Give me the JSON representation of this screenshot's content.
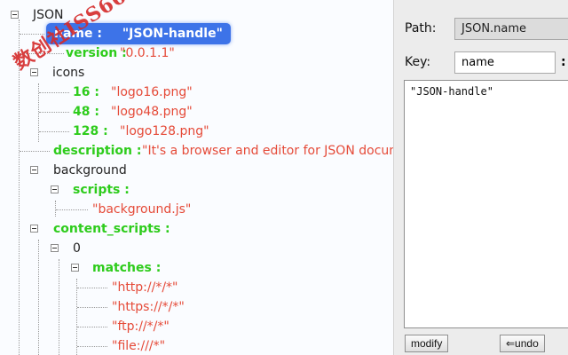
{
  "tree": {
    "root": "JSON",
    "selected": {
      "key": "name",
      "sep": ":",
      "value": "\"JSON-handle\""
    },
    "version": {
      "key": "version",
      "sep": ":",
      "value": "\"0.0.1.1\""
    },
    "icons": {
      "key": "icons"
    },
    "icon16": {
      "key": "16",
      "sep": ":",
      "value": "\"logo16.png\""
    },
    "icon48": {
      "key": "48",
      "sep": ":",
      "value": "\"logo48.png\""
    },
    "icon128": {
      "key": "128",
      "sep": ":",
      "value": "\"logo128.png\""
    },
    "description": {
      "key": "description",
      "sep": ":",
      "value": "\"It's a browser and editor for JSON document."
    },
    "background": {
      "key": "background"
    },
    "scripts": {
      "key": "scripts",
      "sep": ":"
    },
    "script0": {
      "value": "\"background.js\""
    },
    "content_scripts": {
      "key": "content_scripts",
      "sep": ":"
    },
    "cs_index": {
      "key": "0"
    },
    "matches": {
      "key": "matches",
      "sep": ":"
    },
    "m0": {
      "value": "\"http://*/*\""
    },
    "m1": {
      "value": "\"https://*/*\""
    },
    "m2": {
      "value": "\"ftp://*/*\""
    },
    "m3": {
      "value": "\"file:///*\""
    }
  },
  "watermark": "数创社ISS66",
  "editor": {
    "path_label": "Path:",
    "path_value": "JSON.name",
    "key_label": "Key:",
    "key_value": "name",
    "key_sep": ":",
    "value_text": "\"JSON-handle\"",
    "modify_label": "modify",
    "undo_label": "⇐undo"
  },
  "colors": {
    "key": "#2ecc1c",
    "value": "#e54a38",
    "selection": "#3d73e8"
  }
}
